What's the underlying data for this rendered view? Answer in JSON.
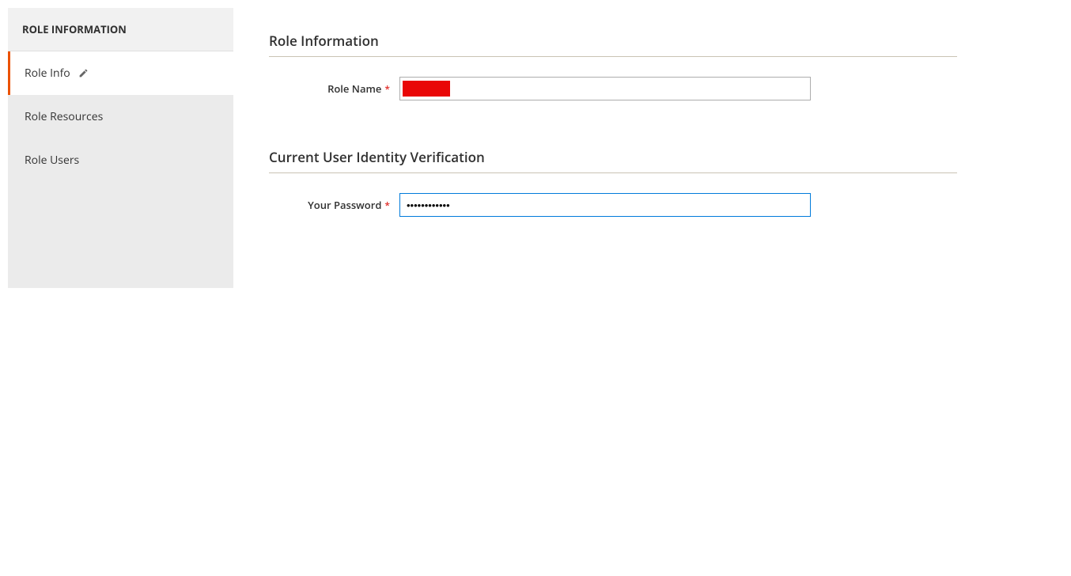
{
  "sidebar": {
    "header": "ROLE INFORMATION",
    "tabs": [
      {
        "label": "Role Info",
        "active": true,
        "hasEdit": true
      },
      {
        "label": "Role Resources",
        "active": false,
        "hasEdit": false
      },
      {
        "label": "Role Users",
        "active": false,
        "hasEdit": false
      }
    ]
  },
  "sections": {
    "roleInfo": {
      "title": "Role Information",
      "roleName": {
        "label": "Role Name",
        "value": ""
      }
    },
    "identity": {
      "title": "Current User Identity Verification",
      "password": {
        "label": "Your Password",
        "value": "••••••••••••"
      }
    }
  }
}
